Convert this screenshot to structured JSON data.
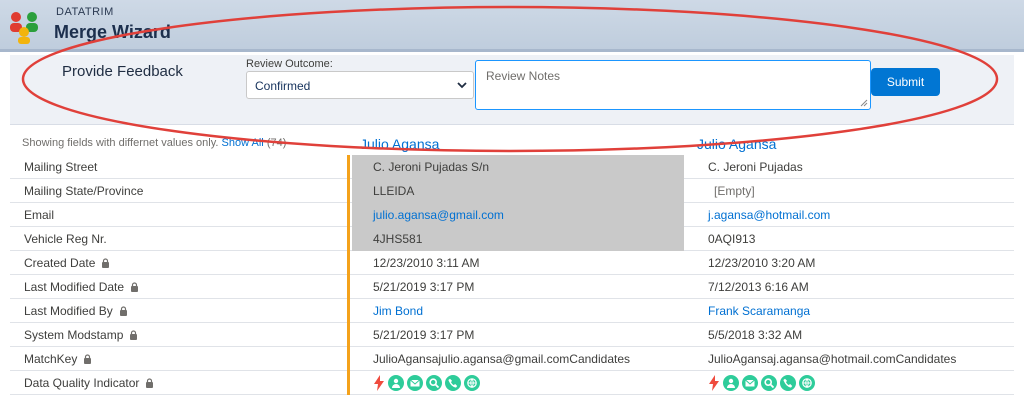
{
  "header": {
    "brand": "DATATRIM",
    "title": "Merge Wizard"
  },
  "feedback": {
    "title": "Provide Feedback",
    "outcome_label": "Review Outcome:",
    "outcome_value": "Confirmed",
    "notes_placeholder": "Review Notes",
    "submit_label": "Submit"
  },
  "summary": {
    "text": "Showing fields with differnet values only.",
    "show_all": "Show All",
    "count": "(74)"
  },
  "records": {
    "a_name": "Julio Agansa",
    "b_name": "Julio Agansa"
  },
  "rows": [
    {
      "label": "Mailing Street",
      "a": "C. Jeroni Pujadas S/n",
      "b": "C. Jeroni Pujadas"
    },
    {
      "label": "Mailing State/Province",
      "a": "LLEIDA",
      "b": "[Empty]"
    },
    {
      "label": "Email",
      "a": "julio.agansa@gmail.com",
      "b": "j.agansa@hotmail.com"
    },
    {
      "label": "Vehicle Reg Nr.",
      "a": "4JHS581",
      "b": "0AQI913"
    },
    {
      "label": "Created Date",
      "a": "12/23/2010 3:11 AM",
      "b": "12/23/2010 3:20 AM"
    },
    {
      "label": "Last Modified Date",
      "a": "5/21/2019 3:17 PM",
      "b": "7/12/2013 6:16 AM"
    },
    {
      "label": "Last Modified By",
      "a": "Jim Bond",
      "b": "Frank Scaramanga"
    },
    {
      "label": "System Modstamp",
      "a": "5/21/2019 3:17 PM",
      "b": "5/5/2018 3:32 AM"
    },
    {
      "label": "MatchKey",
      "a": "JulioAgansajulio.agansa@gmail.comCandidates",
      "b": "JulioAgansaj.agansa@hotmail.comCandidates"
    },
    {
      "label": "Data Quality Indicator"
    }
  ],
  "colors": {
    "accent": "#0176d3",
    "bar": "#f4a21b",
    "annotation": "#e0403a",
    "dq_icon": "#2ecc9a"
  },
  "icons": [
    "merge-logo-icon",
    "chevron-down-icon",
    "lock-icon",
    "lightning-icon",
    "person-icon",
    "mail-icon",
    "search-icon",
    "phone-icon",
    "globe-icon"
  ]
}
